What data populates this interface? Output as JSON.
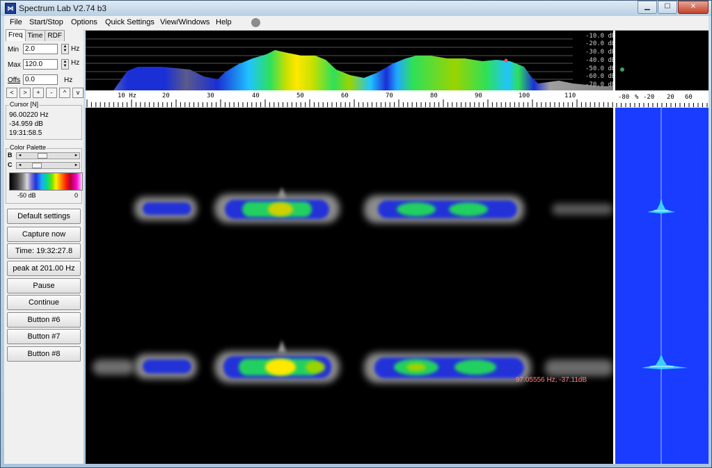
{
  "window": {
    "title": "Spectrum Lab V2.74 b3",
    "app_icon_glyph": "⋈"
  },
  "menu": [
    "File",
    "Start/Stop",
    "Options",
    "Quick Settings",
    "View/Windows",
    "Help"
  ],
  "tabs": [
    "Freq",
    "Time",
    "RDF"
  ],
  "freq": {
    "min_label": "Min",
    "min_value": "2.0",
    "min_unit": "Hz",
    "max_label": "Max",
    "max_value": "120.0",
    "max_unit": "Hz",
    "offs_label": "Offs",
    "offs_value": "0.0",
    "offs_unit": "Hz"
  },
  "nav_buttons": [
    "<",
    ">",
    "+",
    "-",
    "^",
    "v"
  ],
  "cursor": {
    "title": "Cursor [N]",
    "freq": "96.00220 Hz",
    "level": "-34.959 dB",
    "time": "19:31:58.5"
  },
  "palette": {
    "title": "Color Palette",
    "b_label": "B",
    "c_label": "C",
    "min_label": "-50 dB",
    "max_label": "0"
  },
  "buttons": [
    "Default settings",
    "Capture now",
    "Time:  19:32:27.8",
    "peak at 201.00 Hz",
    "Pause",
    "Continue",
    "Button #6",
    "Button #7",
    "Button #8"
  ],
  "spectrum": {
    "db_labels": [
      "-10.0 dB",
      "-20.0 dB",
      "-30.0 dB",
      "-40.0 dB",
      "-50.0 dB",
      "-60.0 dB",
      "-70.0 dB"
    ],
    "freq_ticks": [
      "10 Hz",
      "20",
      "30",
      "40",
      "50",
      "60",
      "70",
      "80",
      "90",
      "100",
      "110"
    ]
  },
  "right_scale": [
    "-80",
    "%",
    "-20",
    "20",
    "60"
  ],
  "waterfall": {
    "marker_text": "97.05556 Hz, -37.11dB"
  },
  "colors": {
    "waterfall_bg": "#000000",
    "right_pane_bg": "#1a3cff",
    "marker_text": "#ff8080"
  }
}
